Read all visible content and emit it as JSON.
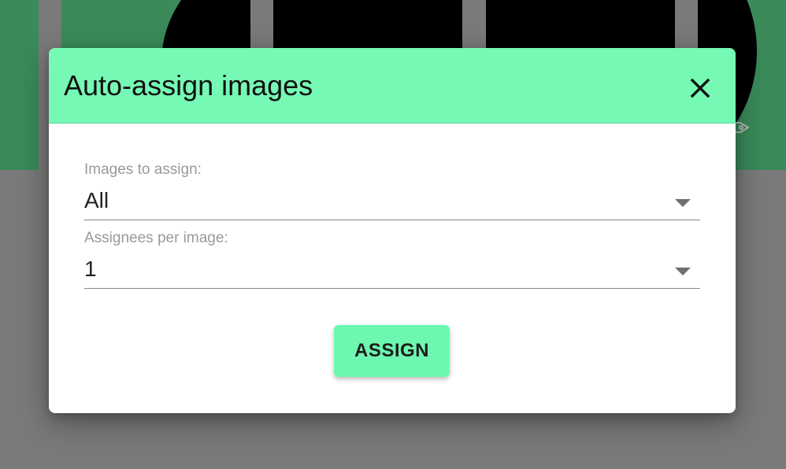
{
  "dialog": {
    "title": "Auto-assign images",
    "close_icon": "close-icon"
  },
  "fields": {
    "images_to_assign": {
      "label": "Images to assign:",
      "value": "All"
    },
    "assignees_per_image": {
      "label": "Assignees per image:",
      "value": "1"
    }
  },
  "actions": {
    "assign_label": "ASSIGN"
  },
  "background": {
    "tag_icon": "tag-icon"
  },
  "colors": {
    "header_accent": "#75f9b4",
    "button_accent": "#6df7b0",
    "overlay": "#7a7a7a",
    "tile_green": "#3a8a5a"
  }
}
